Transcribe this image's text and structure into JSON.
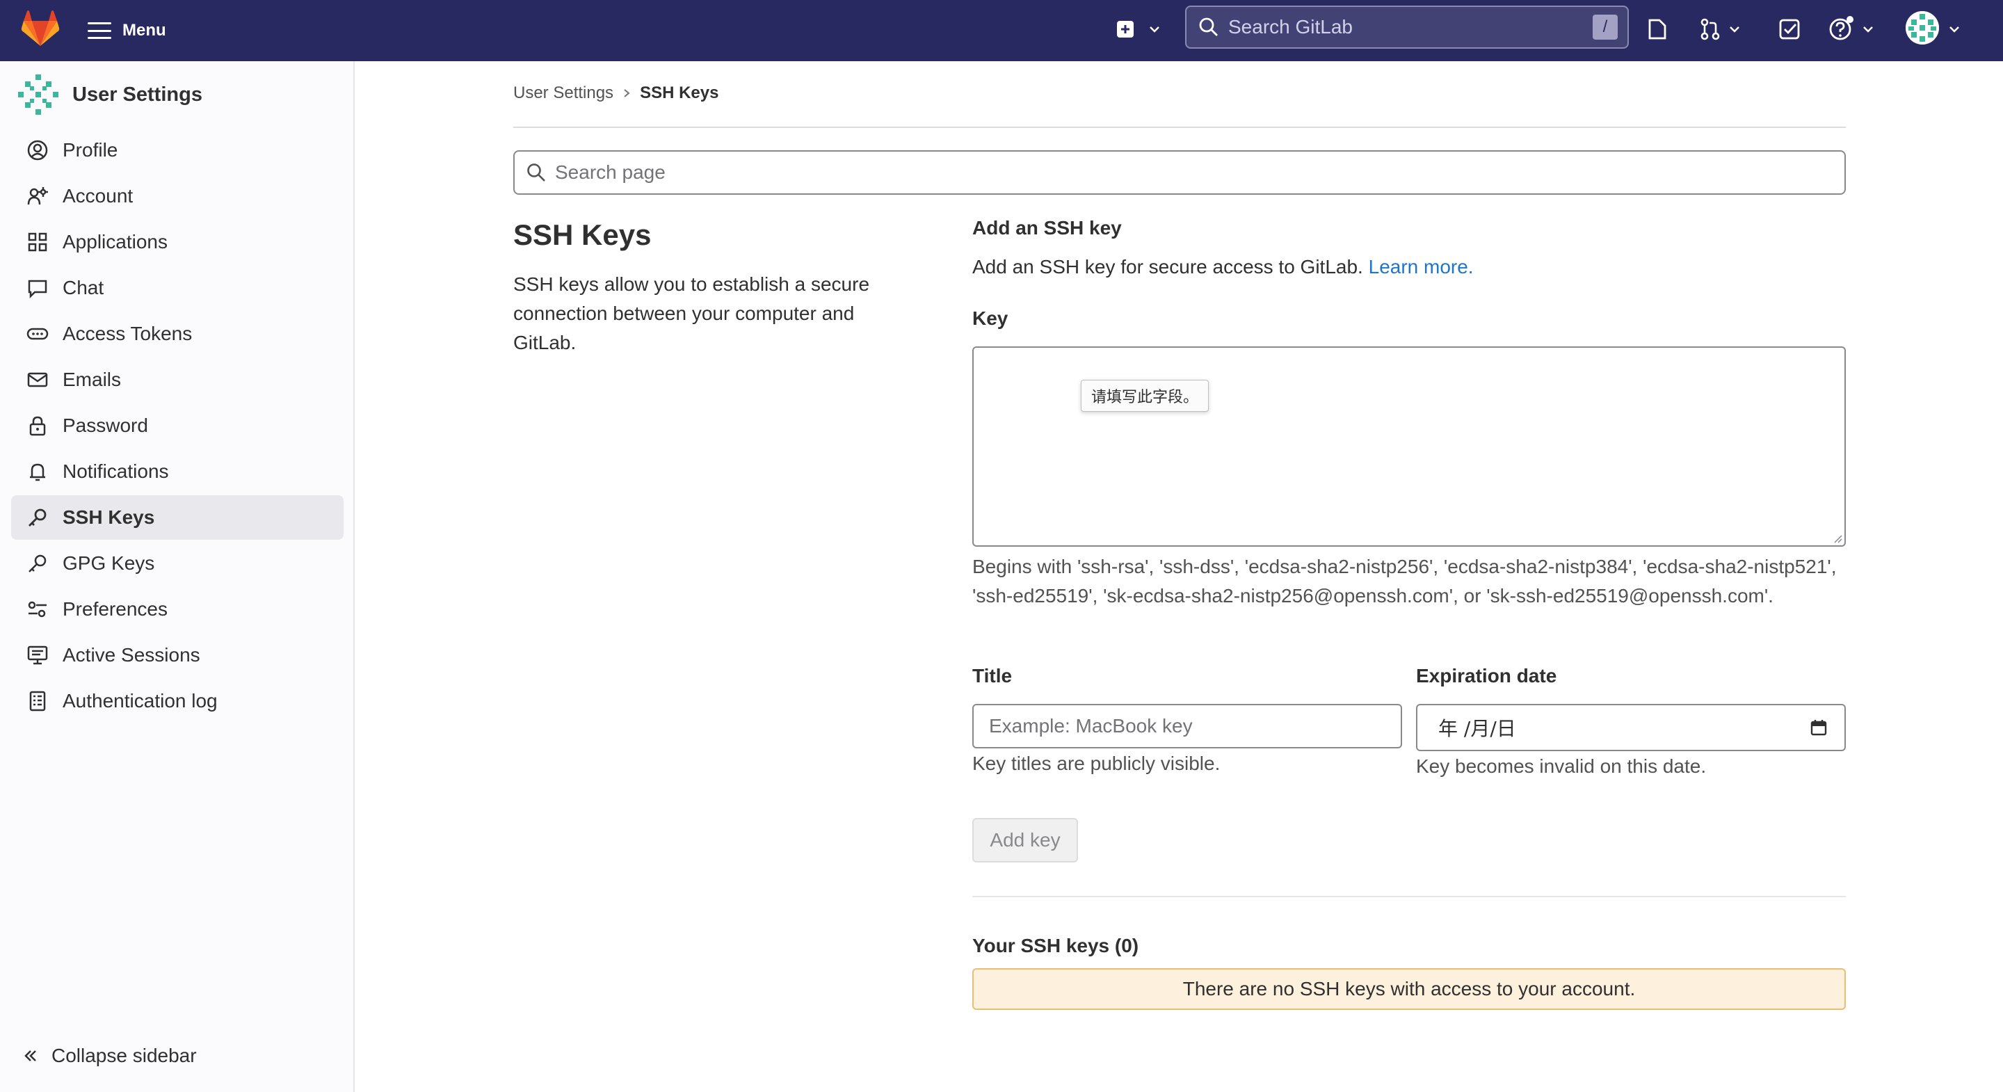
{
  "topbar": {
    "menu_label": "Menu",
    "search_placeholder": "Search GitLab",
    "search_shortcut": "/",
    "icons": [
      "gitlab-logo",
      "plus-square-icon",
      "issues-icon",
      "merge-request-icon",
      "todo-icon",
      "help-icon",
      "avatar"
    ]
  },
  "sidebar": {
    "title": "User Settings",
    "items": [
      {
        "label": "Profile",
        "icon": "profile-icon"
      },
      {
        "label": "Account",
        "icon": "account-icon"
      },
      {
        "label": "Applications",
        "icon": "applications-icon"
      },
      {
        "label": "Chat",
        "icon": "chat-icon"
      },
      {
        "label": "Access Tokens",
        "icon": "token-icon"
      },
      {
        "label": "Emails",
        "icon": "mail-icon"
      },
      {
        "label": "Password",
        "icon": "lock-icon"
      },
      {
        "label": "Notifications",
        "icon": "bell-icon"
      },
      {
        "label": "SSH Keys",
        "icon": "key-icon",
        "active": true
      },
      {
        "label": "GPG Keys",
        "icon": "key-icon"
      },
      {
        "label": "Preferences",
        "icon": "preferences-icon"
      },
      {
        "label": "Active Sessions",
        "icon": "monitor-icon"
      },
      {
        "label": "Authentication log",
        "icon": "log-icon"
      }
    ],
    "collapse_label": "Collapse sidebar"
  },
  "breadcrumb": {
    "parent": "User Settings",
    "current": "SSH Keys"
  },
  "page_search_placeholder": "Search page",
  "intro": {
    "title": "SSH Keys",
    "description": "SSH keys allow you to establish a secure connection between your computer and GitLab."
  },
  "form": {
    "heading": "Add an SSH key",
    "description": "Add an SSH key for secure access to GitLab.",
    "learn_more": "Learn more.",
    "key_label": "Key",
    "key_tooltip": "请填写此字段。",
    "key_help": "Begins with 'ssh-rsa', 'ssh-dss', 'ecdsa-sha2-nistp256', 'ecdsa-sha2-nistp384', 'ecdsa-sha2-nistp521', 'ssh-ed25519', 'sk-ecdsa-sha2-nistp256@openssh.com', or 'sk-ssh-ed25519@openssh.com'.",
    "title_label": "Title",
    "title_placeholder": "Example: MacBook key",
    "title_help": "Key titles are publicly visible.",
    "expiration_label": "Expiration date",
    "expiration_value": "年 /月/日",
    "expiration_help": "Key becomes invalid on this date.",
    "add_button": "Add key"
  },
  "keys_list": {
    "heading": "Your SSH keys (0)",
    "empty_message": "There are no SSH keys with access to your account."
  },
  "colors": {
    "navbar": "#292961",
    "link": "#1f75cb",
    "alert_bg": "#fdf1dd",
    "alert_border": "#e9be74"
  }
}
